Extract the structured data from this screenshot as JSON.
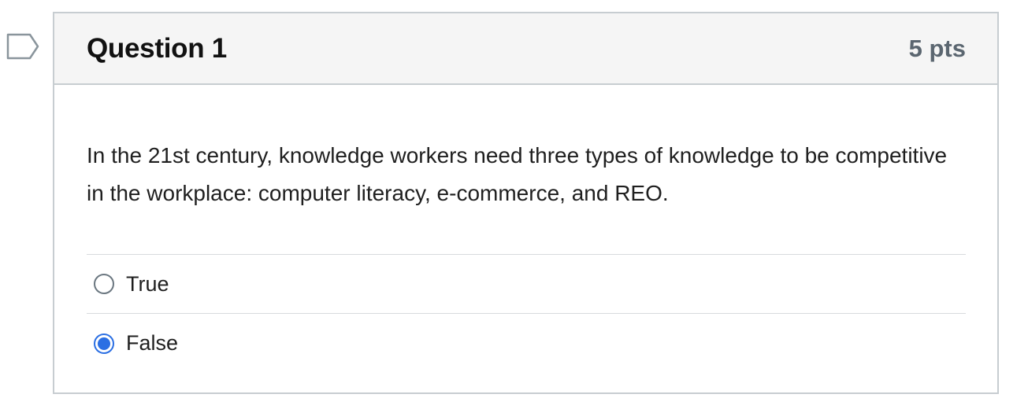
{
  "question": {
    "title": "Question 1",
    "points": "5 pts",
    "text": "In the 21st century, knowledge workers need three types of knowledge to be competitive in the workplace: computer literacy, e-commerce, and REO.",
    "flag_icon": "flag-outline-icon",
    "answers": [
      {
        "label": "True",
        "selected": false
      },
      {
        "label": "False",
        "selected": true
      }
    ]
  },
  "colors": {
    "accent": "#2b6fe3",
    "header_bg": "#f5f5f5",
    "border": "#c7cdd1"
  }
}
